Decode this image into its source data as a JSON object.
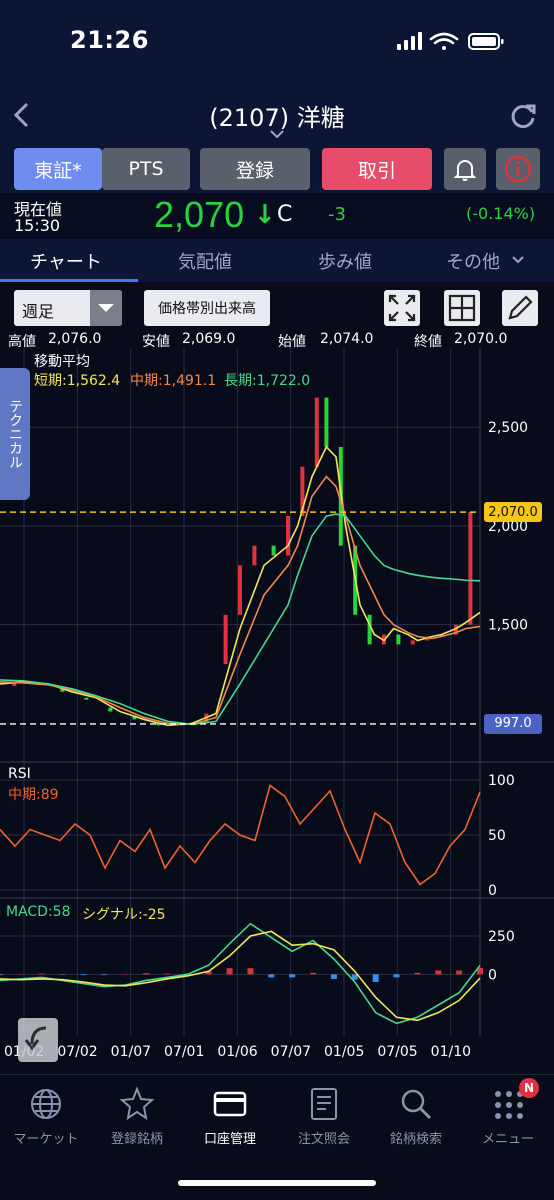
{
  "status": {
    "time": "21:26"
  },
  "nav": {
    "title": "(2107) 洋糖",
    "back_icon": "chevron-left-icon",
    "refresh_icon": "refresh-icon"
  },
  "actions": {
    "tse": "東証*",
    "pts": "PTS",
    "register": "登録",
    "trade": "取引",
    "colors": {
      "active": "#6f8df0",
      "inactive": "#5a5f6c",
      "trade": "#e84c6b",
      "alert": "#e2313e"
    }
  },
  "quote": {
    "label": "現在値",
    "time": "15:30",
    "price": "2,070",
    "arrow": "↓",
    "suffix": "C",
    "change": "-3",
    "change_pct": "(-0.14%)",
    "up_color": "#29d33d"
  },
  "tabs": [
    "チャート",
    "気配値",
    "歩み値",
    "その他"
  ],
  "toolbar": {
    "period": "週足",
    "volume_btn": "価格帯別出来高"
  },
  "ohlc": {
    "high_label": "高値",
    "high": "2,076.0",
    "low_label": "安値",
    "low": "2,069.0",
    "open_label": "始値",
    "open": "2,074.0",
    "close_label": "終値",
    "close": "2,070.0"
  },
  "technical_tab": "テクニカル",
  "ma": {
    "title": "移動平均",
    "short": "短期:1,562.4",
    "mid": "中期:1,491.1",
    "long": "長期:1,722.0",
    "short_color": "#f4e65c",
    "mid_color": "#f08a4b",
    "long_color": "#45d98a"
  },
  "rsi": {
    "title": "RSI",
    "mid": "中期:89",
    "color": "#f0632e"
  },
  "macd": {
    "macd": "MACD:58",
    "signal": "シグナル:-25"
  },
  "x_labels": [
    "01/02",
    "07/02",
    "01/07",
    "07/01",
    "01/06",
    "07/07",
    "01/05",
    "07/05",
    "01/10"
  ],
  "chart_data": [
    {
      "type": "line",
      "title": "移動平均",
      "ylim": [
        850,
        2800
      ],
      "y_ticks": [
        "2,500",
        "2,000",
        "1,500"
      ],
      "y_tick_values": [
        2500,
        2000,
        1500
      ],
      "current_price_label": "2,070.0",
      "current_price": 2070,
      "low_marker_label": "997.0",
      "low_marker": 997,
      "x": [
        0,
        5,
        10,
        15,
        20,
        25,
        30,
        35,
        40,
        45,
        50,
        55,
        60,
        62,
        65,
        68,
        70,
        72,
        75,
        78,
        80,
        82,
        85,
        87,
        90,
        92,
        95,
        97,
        100
      ],
      "series": [
        {
          "name": "短期:1,562.4",
          "values": [
            1200,
            1210,
            1200,
            1160,
            1130,
            1060,
            1020,
            990,
            1000,
            1050,
            1480,
            1800,
            1900,
            2000,
            2250,
            2400,
            2350,
            2000,
            1600,
            1450,
            1420,
            1480,
            1450,
            1420,
            1440,
            1450,
            1480,
            1510,
            1562
          ]
        },
        {
          "name": "中期:1,491.1",
          "values": [
            1210,
            1205,
            1195,
            1170,
            1135,
            1080,
            1030,
            1000,
            995,
            1030,
            1350,
            1650,
            1800,
            1900,
            2150,
            2250,
            2200,
            2050,
            1800,
            1650,
            1550,
            1500,
            1460,
            1440,
            1430,
            1440,
            1460,
            1480,
            1491
          ]
        },
        {
          "name": "長期:1,722.0",
          "values": [
            1220,
            1215,
            1200,
            1175,
            1140,
            1100,
            1050,
            1010,
            995,
            1010,
            1200,
            1400,
            1600,
            1750,
            1950,
            2050,
            2060,
            2050,
            1950,
            1850,
            1800,
            1780,
            1760,
            1750,
            1740,
            1735,
            1730,
            1725,
            1722
          ]
        }
      ],
      "candles": [
        {
          "x": 3,
          "o": 1190,
          "c": 1205
        },
        {
          "x": 8,
          "o": 1205,
          "c": 1200
        },
        {
          "x": 13,
          "o": 1180,
          "c": 1160
        },
        {
          "x": 18,
          "o": 1130,
          "c": 1120
        },
        {
          "x": 23,
          "o": 1080,
          "c": 1060
        },
        {
          "x": 28,
          "o": 1040,
          "c": 1020
        },
        {
          "x": 33,
          "o": 1000,
          "c": 990
        },
        {
          "x": 38,
          "o": 995,
          "c": 1000
        },
        {
          "x": 43,
          "o": 1000,
          "c": 1050
        },
        {
          "x": 47,
          "o": 1300,
          "c": 1550
        },
        {
          "x": 50,
          "o": 1550,
          "c": 1800
        },
        {
          "x": 53,
          "o": 1800,
          "c": 1900
        },
        {
          "x": 57,
          "o": 1900,
          "c": 1850
        },
        {
          "x": 60,
          "o": 1850,
          "c": 2050
        },
        {
          "x": 63,
          "o": 2050,
          "c": 2300
        },
        {
          "x": 66,
          "o": 2300,
          "c": 2650
        },
        {
          "x": 68,
          "o": 2650,
          "c": 2400
        },
        {
          "x": 71,
          "o": 2400,
          "c": 1900
        },
        {
          "x": 74,
          "o": 1900,
          "c": 1550
        },
        {
          "x": 77,
          "o": 1550,
          "c": 1400
        },
        {
          "x": 80,
          "o": 1400,
          "c": 1450
        },
        {
          "x": 83,
          "o": 1450,
          "c": 1400
        },
        {
          "x": 86,
          "o": 1400,
          "c": 1420
        },
        {
          "x": 89,
          "o": 1420,
          "c": 1440
        },
        {
          "x": 92,
          "o": 1440,
          "c": 1450
        },
        {
          "x": 95,
          "o": 1450,
          "c": 1500
        },
        {
          "x": 98,
          "o": 1500,
          "c": 2070
        }
      ]
    },
    {
      "type": "line",
      "title": "RSI",
      "ylim": [
        0,
        100
      ],
      "y_ticks": [
        "100",
        "50",
        "0"
      ],
      "y_tick_values": [
        100,
        50,
        0
      ],
      "series": [
        {
          "name": "中期:89",
          "values": [
            55,
            40,
            55,
            50,
            45,
            60,
            50,
            20,
            45,
            35,
            55,
            20,
            40,
            25,
            45,
            60,
            50,
            45,
            95,
            85,
            60,
            75,
            90,
            55,
            25,
            70,
            60,
            25,
            5,
            15,
            40,
            55,
            89
          ]
        }
      ]
    },
    {
      "type": "line",
      "title": "MACD",
      "ylim": [
        -350,
        400
      ],
      "y_ticks": [
        "250",
        "0"
      ],
      "y_tick_values": [
        250,
        0
      ],
      "series": [
        {
          "name": "MACD:58",
          "values": [
            -40,
            -30,
            -20,
            -40,
            -60,
            -80,
            -70,
            -40,
            -20,
            0,
            60,
            200,
            330,
            240,
            150,
            220,
            100,
            -50,
            -250,
            -320,
            -280,
            -200,
            -120,
            58
          ]
        },
        {
          "name": "シグナル:-25",
          "values": [
            -30,
            -35,
            -30,
            -35,
            -50,
            -70,
            -75,
            -55,
            -30,
            -10,
            20,
            120,
            250,
            280,
            190,
            200,
            160,
            20,
            -150,
            -280,
            -300,
            -250,
            -170,
            -25
          ]
        }
      ]
    }
  ],
  "bottom_nav": [
    {
      "label": "マーケット",
      "icon": "globe-icon"
    },
    {
      "label": "登録銘柄",
      "icon": "star-icon"
    },
    {
      "label": "口座管理",
      "icon": "card-icon"
    },
    {
      "label": "注文照会",
      "icon": "document-icon"
    },
    {
      "label": "銘柄検索",
      "icon": "search-icon"
    },
    {
      "label": "メニュー",
      "icon": "menu-icon",
      "badge": "N"
    }
  ]
}
